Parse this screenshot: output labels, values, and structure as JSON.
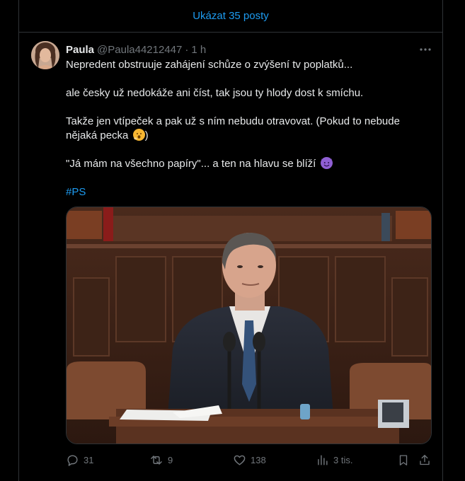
{
  "show_more_label": "Ukázat 35 posty",
  "tweet": {
    "author_name": "Paula",
    "author_handle": "@Paula44212447",
    "separator": "·",
    "time": "1 h",
    "paragraphs": [
      "Nepredent obstruuje zahájení schůze o zvýšení tv poplatků...",
      "ale česky už nedokáže ani číst, tak jsou ty hlody dost k smíchu.",
      "Takže jen vtípeček a pak už s ním nebudu otravovat. (Pokud to nebude nějaká pecka",
      "\"Já mám na všechno papíry\"... a ten na hlavu se blíží"
    ],
    "paragraph_3_tail": ")",
    "hashtag": "#PS",
    "emoji_yawn": "yawning-face-emoji",
    "emoji_devil": "smiling-devil-emoji",
    "stats": {
      "replies": "31",
      "reposts": "9",
      "likes": "138",
      "views": "3 tis."
    }
  },
  "colors": {
    "background": "#000000",
    "text": "#e7e9ea",
    "muted": "#71767b",
    "accent": "#1d9bf0",
    "border": "#2f3336"
  }
}
